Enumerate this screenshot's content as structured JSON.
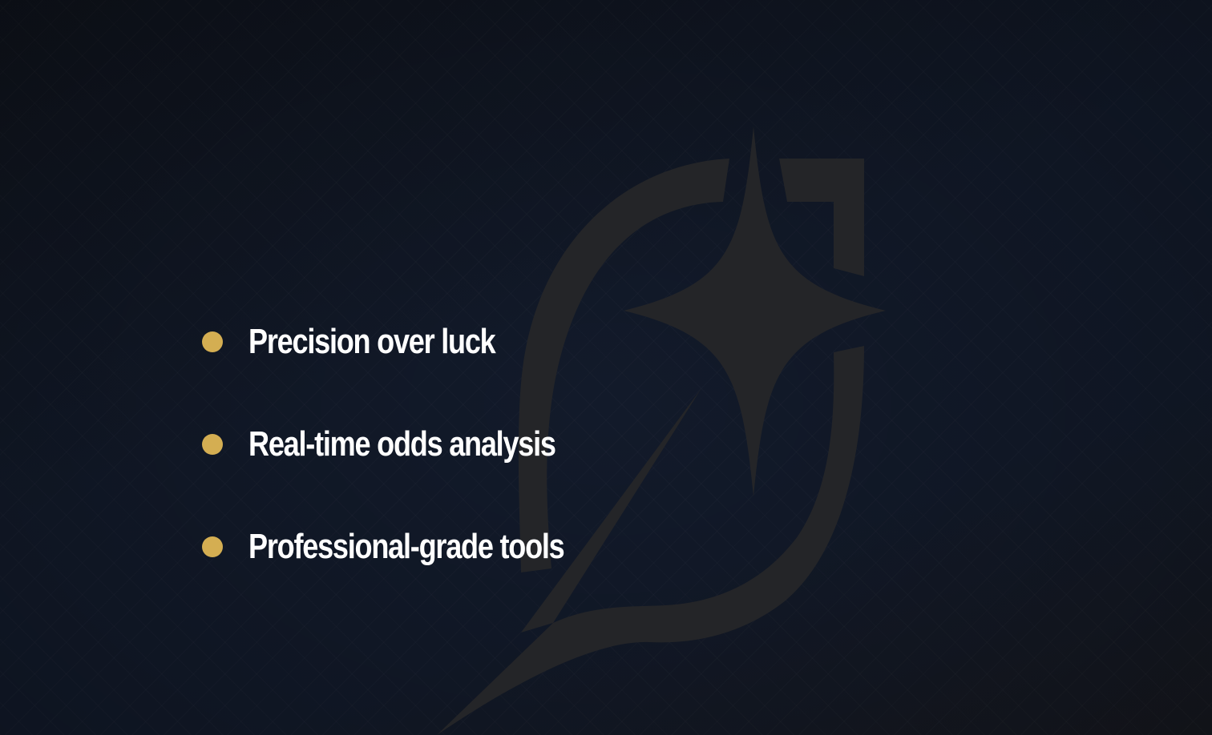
{
  "background": {
    "base_color": "#121a2a",
    "pattern": "diagonal-diamond-grid"
  },
  "logo": {
    "icon": "sparkle-star-logo-icon",
    "color": "#252628"
  },
  "features": {
    "bullet_color": "#d4ae52",
    "items": [
      {
        "label": "Precision over luck"
      },
      {
        "label": "Real-time odds analysis"
      },
      {
        "label": "Professional-grade tools"
      }
    ]
  }
}
